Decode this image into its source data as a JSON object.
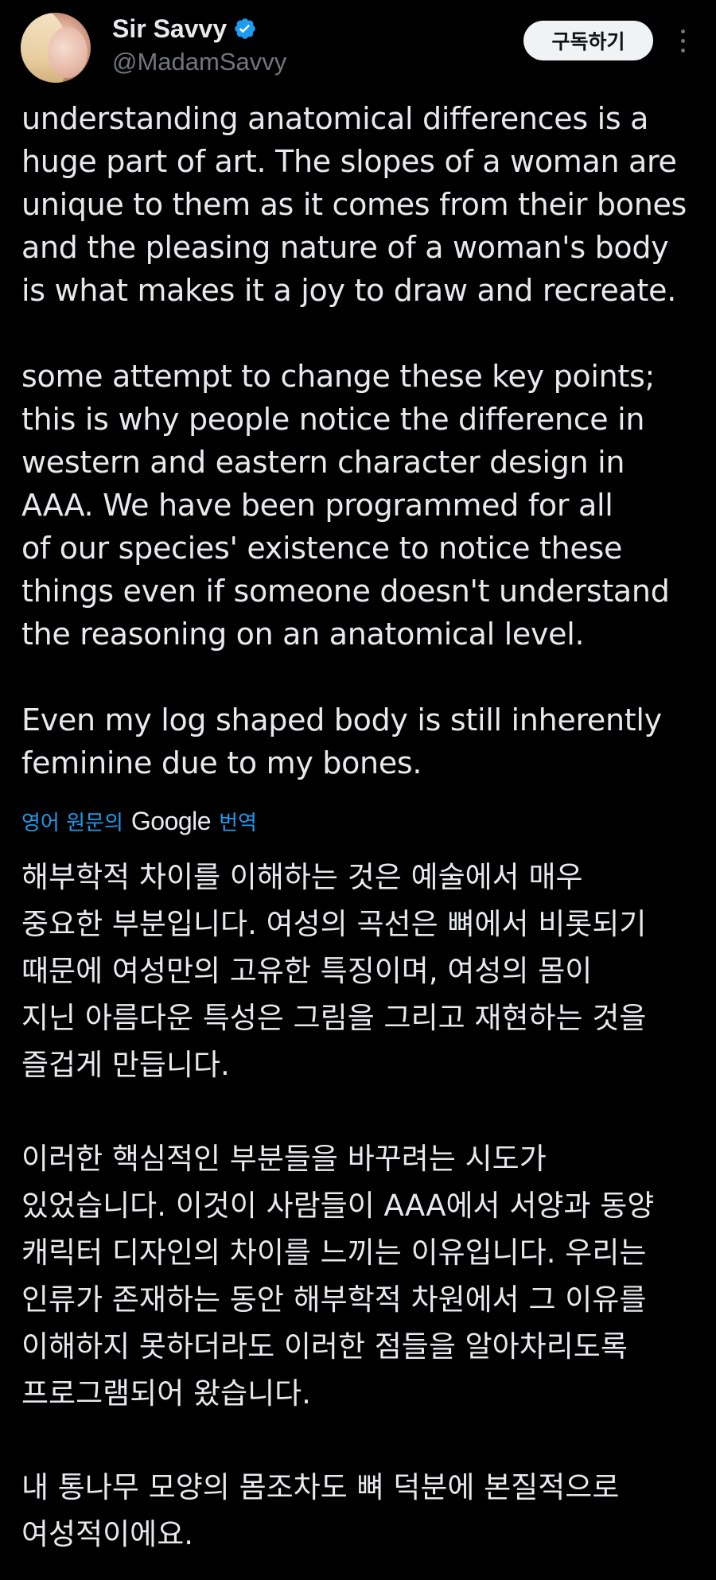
{
  "author": {
    "display_name": "Sir Savvy",
    "handle": "@MadamSavvy",
    "verified": true
  },
  "header": {
    "subscribe_label": "구독하기"
  },
  "tweet": {
    "paragraphs": [
      "understanding anatomical differences is a\nhuge part of art. The slopes of a woman are\nunique to them as it comes from their bones\nand the pleasing nature of a woman's body\nis what makes it a joy to draw and recreate.",
      "some attempt to change these key points;\nthis is why people notice the difference in\nwestern and eastern character design in\nAAA. We have been programmed for all\nof our species' existence to notice these\nthings even if someone doesn't understand\nthe reasoning on an anatomical level.",
      "Even my log shaped body is still inherently\nfeminine due to my bones."
    ]
  },
  "translation": {
    "prefix": "영어 원문의",
    "provider": "Google",
    "suffix": "번역",
    "paragraphs": [
      "해부학적 차이를 이해하는 것은 예술에서 매우\n중요한 부분입니다. 여성의 곡선은 뼈에서 비롯되기\n때문에 여성만의 고유한 특징이며, 여성의 몸이\n지닌 아름다운 특성은 그림을 그리고 재현하는 것을\n즐겁게 만듭니다.",
      "이러한 핵심적인 부분들을 바꾸려는 시도가\n있었습니다. 이것이 사람들이 AAA에서 서양과 동양\n캐릭터 디자인의 차이를 느끼는 이유입니다. 우리는\n인류가 존재하는 동안 해부학적 차원에서 그 이유를\n이해하지 못하더라도 이러한 점들을 알아차리도록\n프로그램되어 왔습니다.",
      "내 통나무 모양의 몸조차도 뼈 덕분에 본질적으로\n여성적이에요."
    ]
  },
  "colors": {
    "background": "#000000",
    "text_primary": "#e7e9ea",
    "text_secondary": "#71767b",
    "accent_blue": "#1d9bf0",
    "button_bg": "#eff3f4"
  },
  "icons": {
    "verified": "verified-badge-icon",
    "more": "more-vertical-icon"
  }
}
